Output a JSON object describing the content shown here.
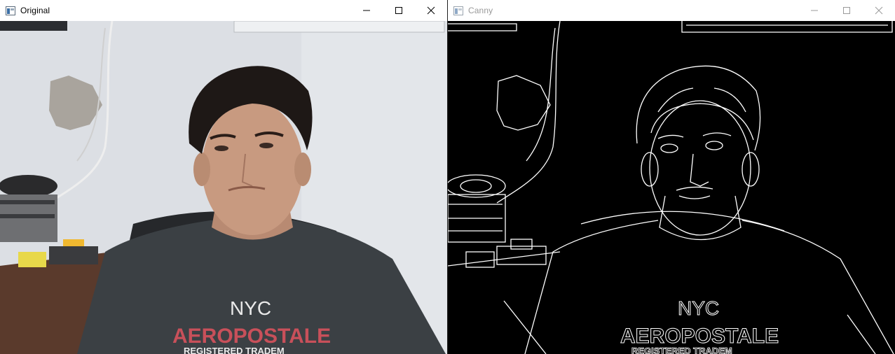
{
  "windows": {
    "original": {
      "title": "Original",
      "active": true
    },
    "canny": {
      "title": "Canny",
      "active": false
    }
  },
  "shirt": {
    "line1": "NYC",
    "line2": "AEROPOSTALE",
    "line3": "REGISTERED TRADEM"
  },
  "colors": {
    "wall": "#dfe2e6",
    "shirt": "#3b4044",
    "hair": "#1e1816",
    "skin": "#c89a80",
    "shirt_red": "#c8505a",
    "edges_bg": "#000000",
    "edges_line": "#ffffff"
  },
  "icons": {
    "app": "window-app-icon",
    "minimize": "minimize-icon",
    "maximize": "maximize-icon",
    "close": "close-icon"
  }
}
